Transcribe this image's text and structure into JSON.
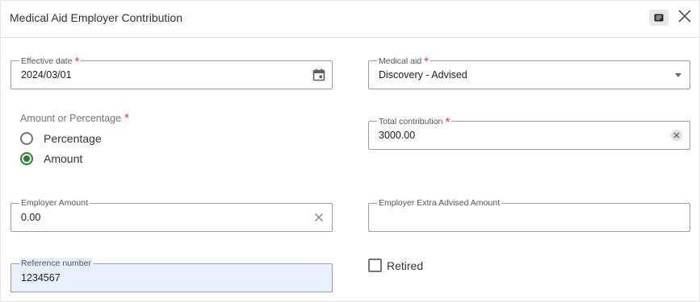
{
  "dialog": {
    "title": "Medical Aid Employer Contribution",
    "notes_icon": "notes-icon",
    "close_icon": "close-icon"
  },
  "fields": {
    "effective_date": {
      "label": "Effective date",
      "required_mark": "*",
      "value": "2024/03/01",
      "icon": "calendar-icon"
    },
    "medical_aid": {
      "label": "Medical aid",
      "required_mark": "*",
      "value": "Discovery - Advised",
      "icon": "dropdown-arrow-icon"
    },
    "amount_or_percentage": {
      "label": "Amount or Percentage",
      "required_mark": "*",
      "options": [
        {
          "label": "Percentage",
          "checked": false
        },
        {
          "label": "Amount",
          "checked": true
        }
      ]
    },
    "total_contribution": {
      "label": "Total contribution",
      "required_mark": "*",
      "value": "3000.00",
      "icon": "clear-icon"
    },
    "employer_amount": {
      "label": "Employer Amount",
      "value": "0.00",
      "icon": "clear-icon"
    },
    "employer_extra_advised_amount": {
      "label": "Employer Extra Advised Amount",
      "value": ""
    },
    "reference_number": {
      "label": "Reference number",
      "value": "1234567"
    },
    "retired": {
      "label": "Retired",
      "checked": false
    }
  },
  "colors": {
    "required": "#e53935",
    "radio_checked": "#2e7d32",
    "shaded_field": "#e8f0fe",
    "border": "#9e9e9e"
  }
}
